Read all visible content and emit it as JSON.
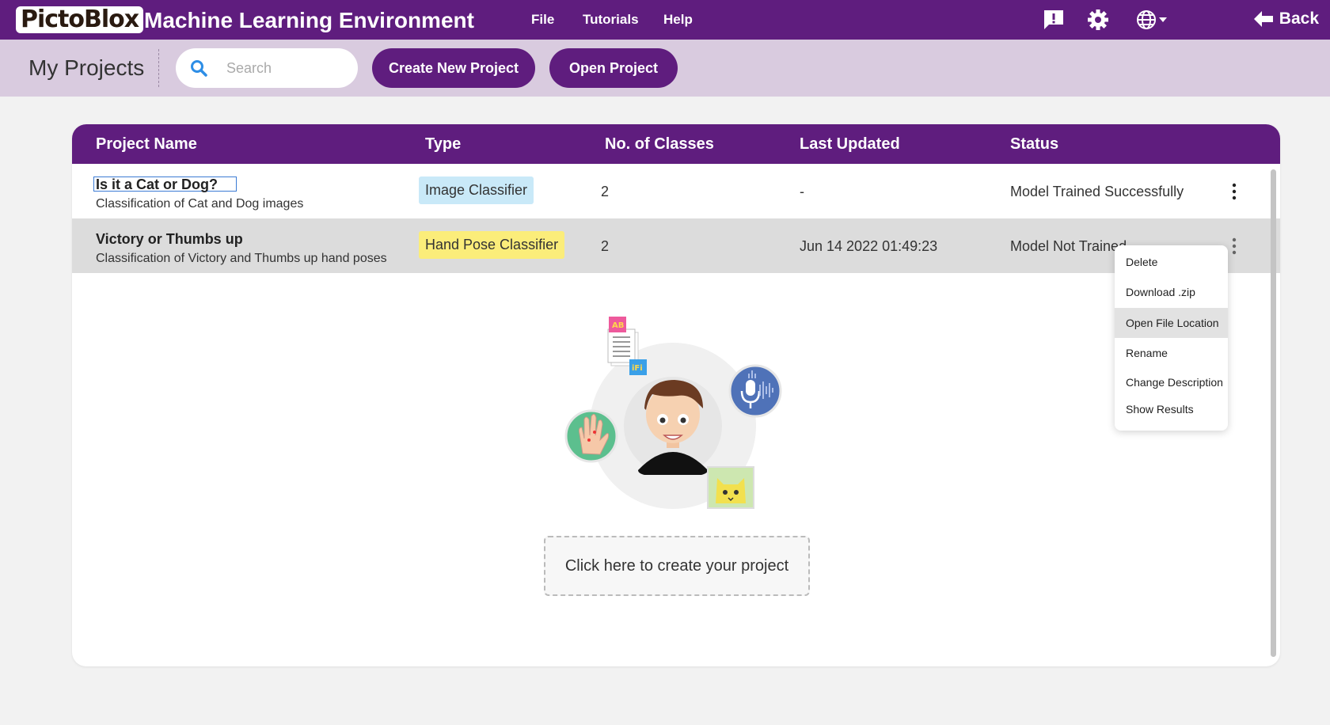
{
  "app": {
    "logo_text": "PictoBlox",
    "title": "Machine Learning Environment",
    "menu": [
      "File",
      "Tutorials",
      "Help"
    ],
    "icons": [
      "feedback-icon",
      "gear-icon",
      "globe-icon"
    ],
    "back_label": "Back"
  },
  "subbar": {
    "page_title": "My Projects",
    "search_placeholder": "Search",
    "create_label": "Create New Project",
    "open_label": "Open Project"
  },
  "table": {
    "headers": [
      "Project Name",
      "Type",
      "No. of Classes",
      "Last Updated",
      "Status"
    ],
    "rows": [
      {
        "name": "Is it a Cat or Dog?",
        "description": "Classification of Cat and Dog images",
        "type": "Image Classifier",
        "type_color": "#c9e9f8",
        "classes": "2",
        "updated": "-",
        "status": "Model Trained Successfully"
      },
      {
        "name": "Victory or Thumbs up",
        "description": "Classification of Victory and Thumbs up hand poses",
        "type": "Hand Pose Classifier",
        "type_color": "#fbed7a",
        "classes": "2",
        "updated": "Jun 14 2022  01:49:23",
        "status": "Model Not Trained"
      }
    ]
  },
  "create_prompt": "Click here to create your project",
  "context_menu": {
    "items": [
      "Delete",
      "Download .zip",
      "Open File Location",
      "Rename",
      "Change Description",
      "Show Results"
    ],
    "highlighted": "Open File Location"
  },
  "colors": {
    "brand_purple": "#5f1d7e",
    "subbar_lilac": "#d9cbdf"
  }
}
